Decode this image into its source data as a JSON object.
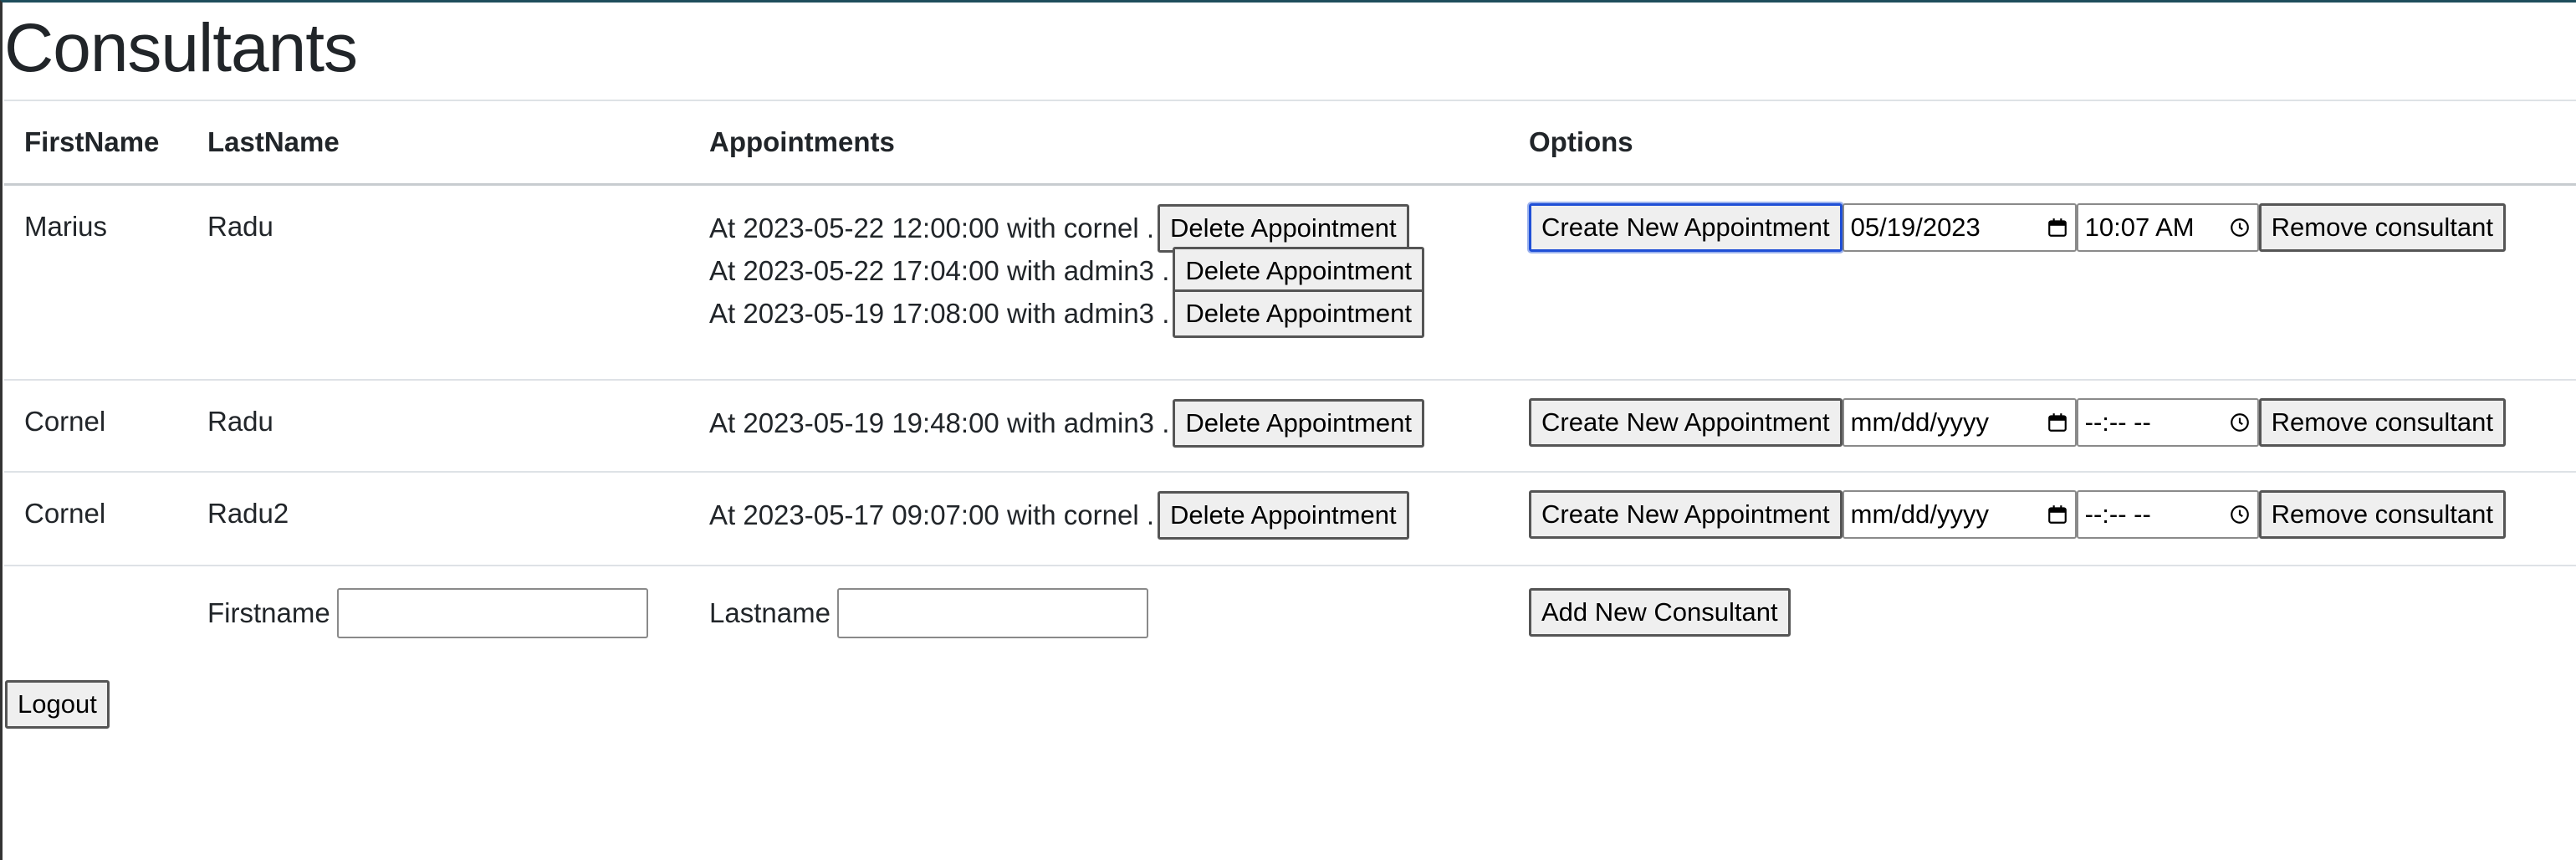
{
  "page": {
    "title": "Consultants"
  },
  "table": {
    "headers": [
      "FirstName",
      "LastName",
      "Appointments",
      "Options"
    ],
    "rows": [
      {
        "first_name": "Marius",
        "last_name": "Radu",
        "appointments": [
          {
            "text": "At 2023-05-22 12:00:00 with cornel .",
            "delete_label": "Delete Appointment"
          },
          {
            "text": "At 2023-05-22 17:04:00 with admin3 .",
            "delete_label": "Delete Appointment"
          },
          {
            "text": "At 2023-05-19 17:08:00 with admin3 .",
            "delete_label": "Delete Appointment"
          }
        ],
        "create_label": "Create New Appointment",
        "date_value": "05/19/2023",
        "time_value": "10:07  AM",
        "remove_label": "Remove consultant"
      },
      {
        "first_name": "Cornel",
        "last_name": "Radu",
        "appointments": [
          {
            "text": "At 2023-05-19 19:48:00 with admin3 .",
            "delete_label": "Delete Appointment"
          }
        ],
        "create_label": "Create New Appointment",
        "date_value": "mm/dd/yyyy",
        "time_value": "--:-- --",
        "remove_label": "Remove consultant"
      },
      {
        "first_name": "Cornel",
        "last_name": "Radu2",
        "appointments": [
          {
            "text": "At 2023-05-17 09:07:00 with cornel .",
            "delete_label": "Delete Appointment"
          }
        ],
        "create_label": "Create New Appointment",
        "date_value": "mm/dd/yyyy",
        "time_value": "--:-- --",
        "remove_label": "Remove consultant"
      }
    ]
  },
  "add_form": {
    "firstname_label": "Firstname",
    "firstname_value": "",
    "lastname_label": "Lastname",
    "lastname_value": "",
    "add_label": "Add New Consultant"
  },
  "logout_label": "Logout",
  "colors": {
    "header_bar": "#1e4d5c",
    "focus": "#1f4fd6"
  }
}
